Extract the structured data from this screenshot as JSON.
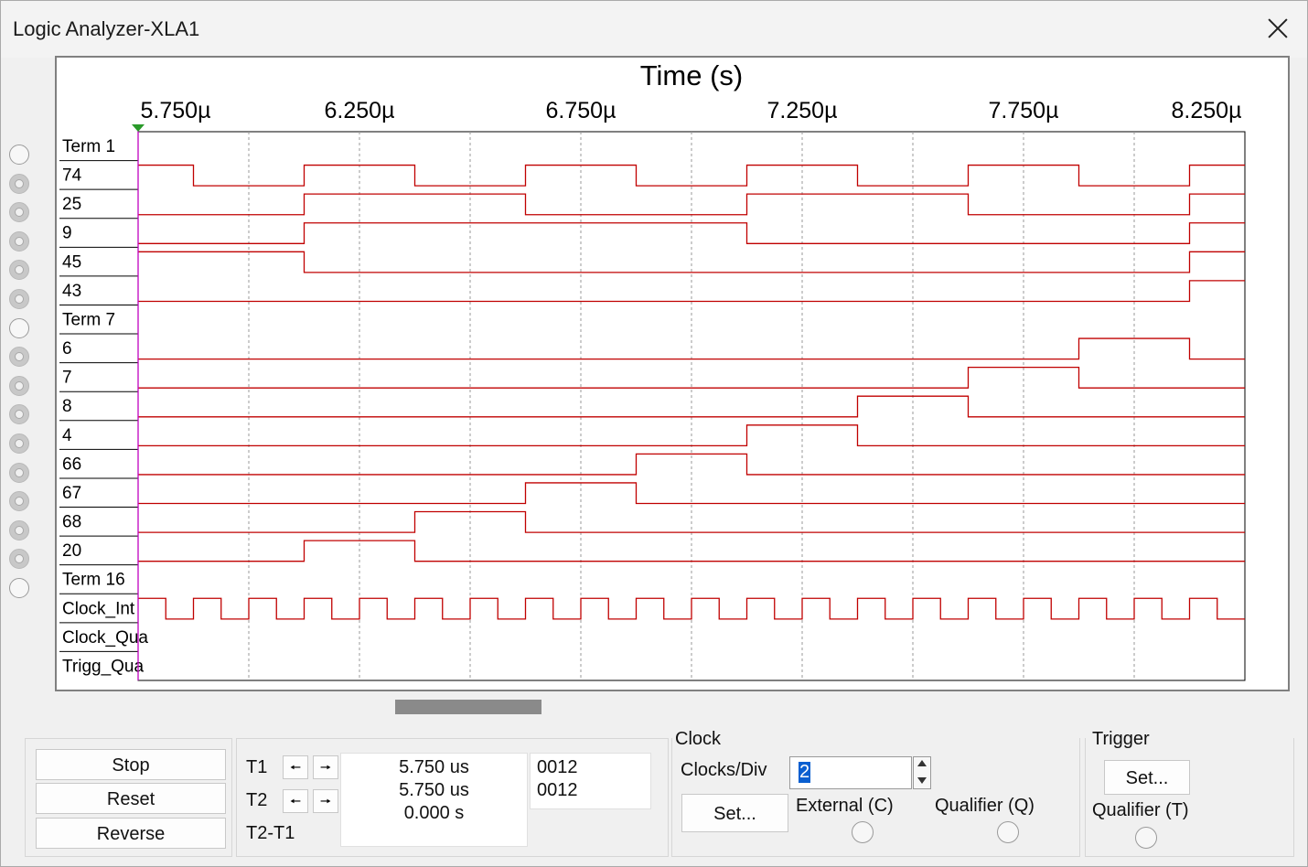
{
  "window": {
    "title": "Logic Analyzer-XLA1"
  },
  "display": {
    "axis_title": "Time (s)",
    "ticks": [
      "5.750µ",
      "6.250µ",
      "6.750µ",
      "7.250µ",
      "7.750µ",
      "8.250µ"
    ],
    "channels": [
      {
        "label": "Term 1",
        "wave": null
      },
      {
        "label": "74",
        "wave": [
          1,
          0,
          0,
          1,
          1,
          0,
          0,
          1,
          1,
          0,
          0,
          1,
          1,
          0,
          0,
          1,
          1,
          0,
          0,
          1
        ]
      },
      {
        "label": "25",
        "wave": [
          0,
          0,
          0,
          1,
          1,
          1,
          1,
          0,
          0,
          0,
          0,
          1,
          1,
          1,
          1,
          0,
          0,
          0,
          0,
          1
        ]
      },
      {
        "label": "9",
        "wave": [
          0,
          0,
          0,
          1,
          1,
          1,
          1,
          1,
          1,
          1,
          1,
          0,
          0,
          0,
          0,
          0,
          0,
          0,
          0,
          1
        ]
      },
      {
        "label": "45",
        "wave": [
          1,
          1,
          1,
          0,
          0,
          0,
          0,
          0,
          0,
          0,
          0,
          0,
          0,
          0,
          0,
          0,
          0,
          0,
          0,
          1
        ]
      },
      {
        "label": "43",
        "wave": [
          0,
          0,
          0,
          0,
          0,
          0,
          0,
          0,
          0,
          0,
          0,
          0,
          0,
          0,
          0,
          0,
          0,
          0,
          0,
          1
        ]
      },
      {
        "label": "Term 7",
        "wave": null
      },
      {
        "label": "6",
        "wave": [
          0,
          0,
          0,
          0,
          0,
          0,
          0,
          0,
          0,
          0,
          0,
          0,
          0,
          0,
          0,
          0,
          0,
          1,
          1,
          0
        ]
      },
      {
        "label": "7",
        "wave": [
          0,
          0,
          0,
          0,
          0,
          0,
          0,
          0,
          0,
          0,
          0,
          0,
          0,
          0,
          0,
          1,
          1,
          0,
          0,
          0
        ]
      },
      {
        "label": "8",
        "wave": [
          0,
          0,
          0,
          0,
          0,
          0,
          0,
          0,
          0,
          0,
          0,
          0,
          0,
          1,
          1,
          0,
          0,
          0,
          0,
          0
        ]
      },
      {
        "label": "4",
        "wave": [
          0,
          0,
          0,
          0,
          0,
          0,
          0,
          0,
          0,
          0,
          0,
          1,
          1,
          0,
          0,
          0,
          0,
          0,
          0,
          0
        ]
      },
      {
        "label": "66",
        "wave": [
          0,
          0,
          0,
          0,
          0,
          0,
          0,
          0,
          0,
          1,
          1,
          0,
          0,
          0,
          0,
          0,
          0,
          0,
          0,
          0
        ]
      },
      {
        "label": "67",
        "wave": [
          0,
          0,
          0,
          0,
          0,
          0,
          0,
          1,
          1,
          0,
          0,
          0,
          0,
          0,
          0,
          0,
          0,
          0,
          0,
          0
        ]
      },
      {
        "label": "68",
        "wave": [
          0,
          0,
          0,
          0,
          0,
          1,
          1,
          0,
          0,
          0,
          0,
          0,
          0,
          0,
          0,
          0,
          0,
          0,
          0,
          0
        ]
      },
      {
        "label": "20",
        "wave": [
          0,
          0,
          0,
          1,
          1,
          0,
          0,
          0,
          0,
          0,
          0,
          0,
          0,
          0,
          0,
          0,
          0,
          0,
          0,
          0
        ]
      },
      {
        "label": "Term 16",
        "wave": null
      },
      {
        "label": "Clock_Int",
        "wave": "clock"
      },
      {
        "label": "Clock_Qua",
        "wave": null
      },
      {
        "label": "Trigg_Qua",
        "wave": null
      }
    ],
    "channel_radios": [
      "empty",
      "filled",
      "filled",
      "filled",
      "filled",
      "filled",
      "empty",
      "filled",
      "filled",
      "filled",
      "filled",
      "filled",
      "filled",
      "filled",
      "filled",
      "empty"
    ],
    "colors": {
      "trace": "#c00000",
      "cursor": "#c000c0",
      "grid": "#999999",
      "text": "#000000"
    }
  },
  "controls": {
    "stop": "Stop",
    "reset": "Reset",
    "reverse": "Reverse",
    "t1_label": "T1",
    "t2_label": "T2",
    "t2t1_label": "T2-T1",
    "left_arrow_icon": "arrow-left-icon",
    "right_arrow_icon": "arrow-right-icon",
    "t1_time": "5.750 us",
    "t2_time": "5.750 us",
    "delta_time": "0.000 s",
    "t1_value": "0012",
    "t2_value": "0012"
  },
  "clock": {
    "title": "Clock",
    "clocks_div_label": "Clocks/Div",
    "clocks_div_value": "2",
    "set_label": "Set...",
    "external_label": "External (C)",
    "qualifier_label": "Qualifier (Q)"
  },
  "trigger": {
    "title": "Trigger",
    "set_label": "Set...",
    "qualifier_label": "Qualifier (T)"
  }
}
